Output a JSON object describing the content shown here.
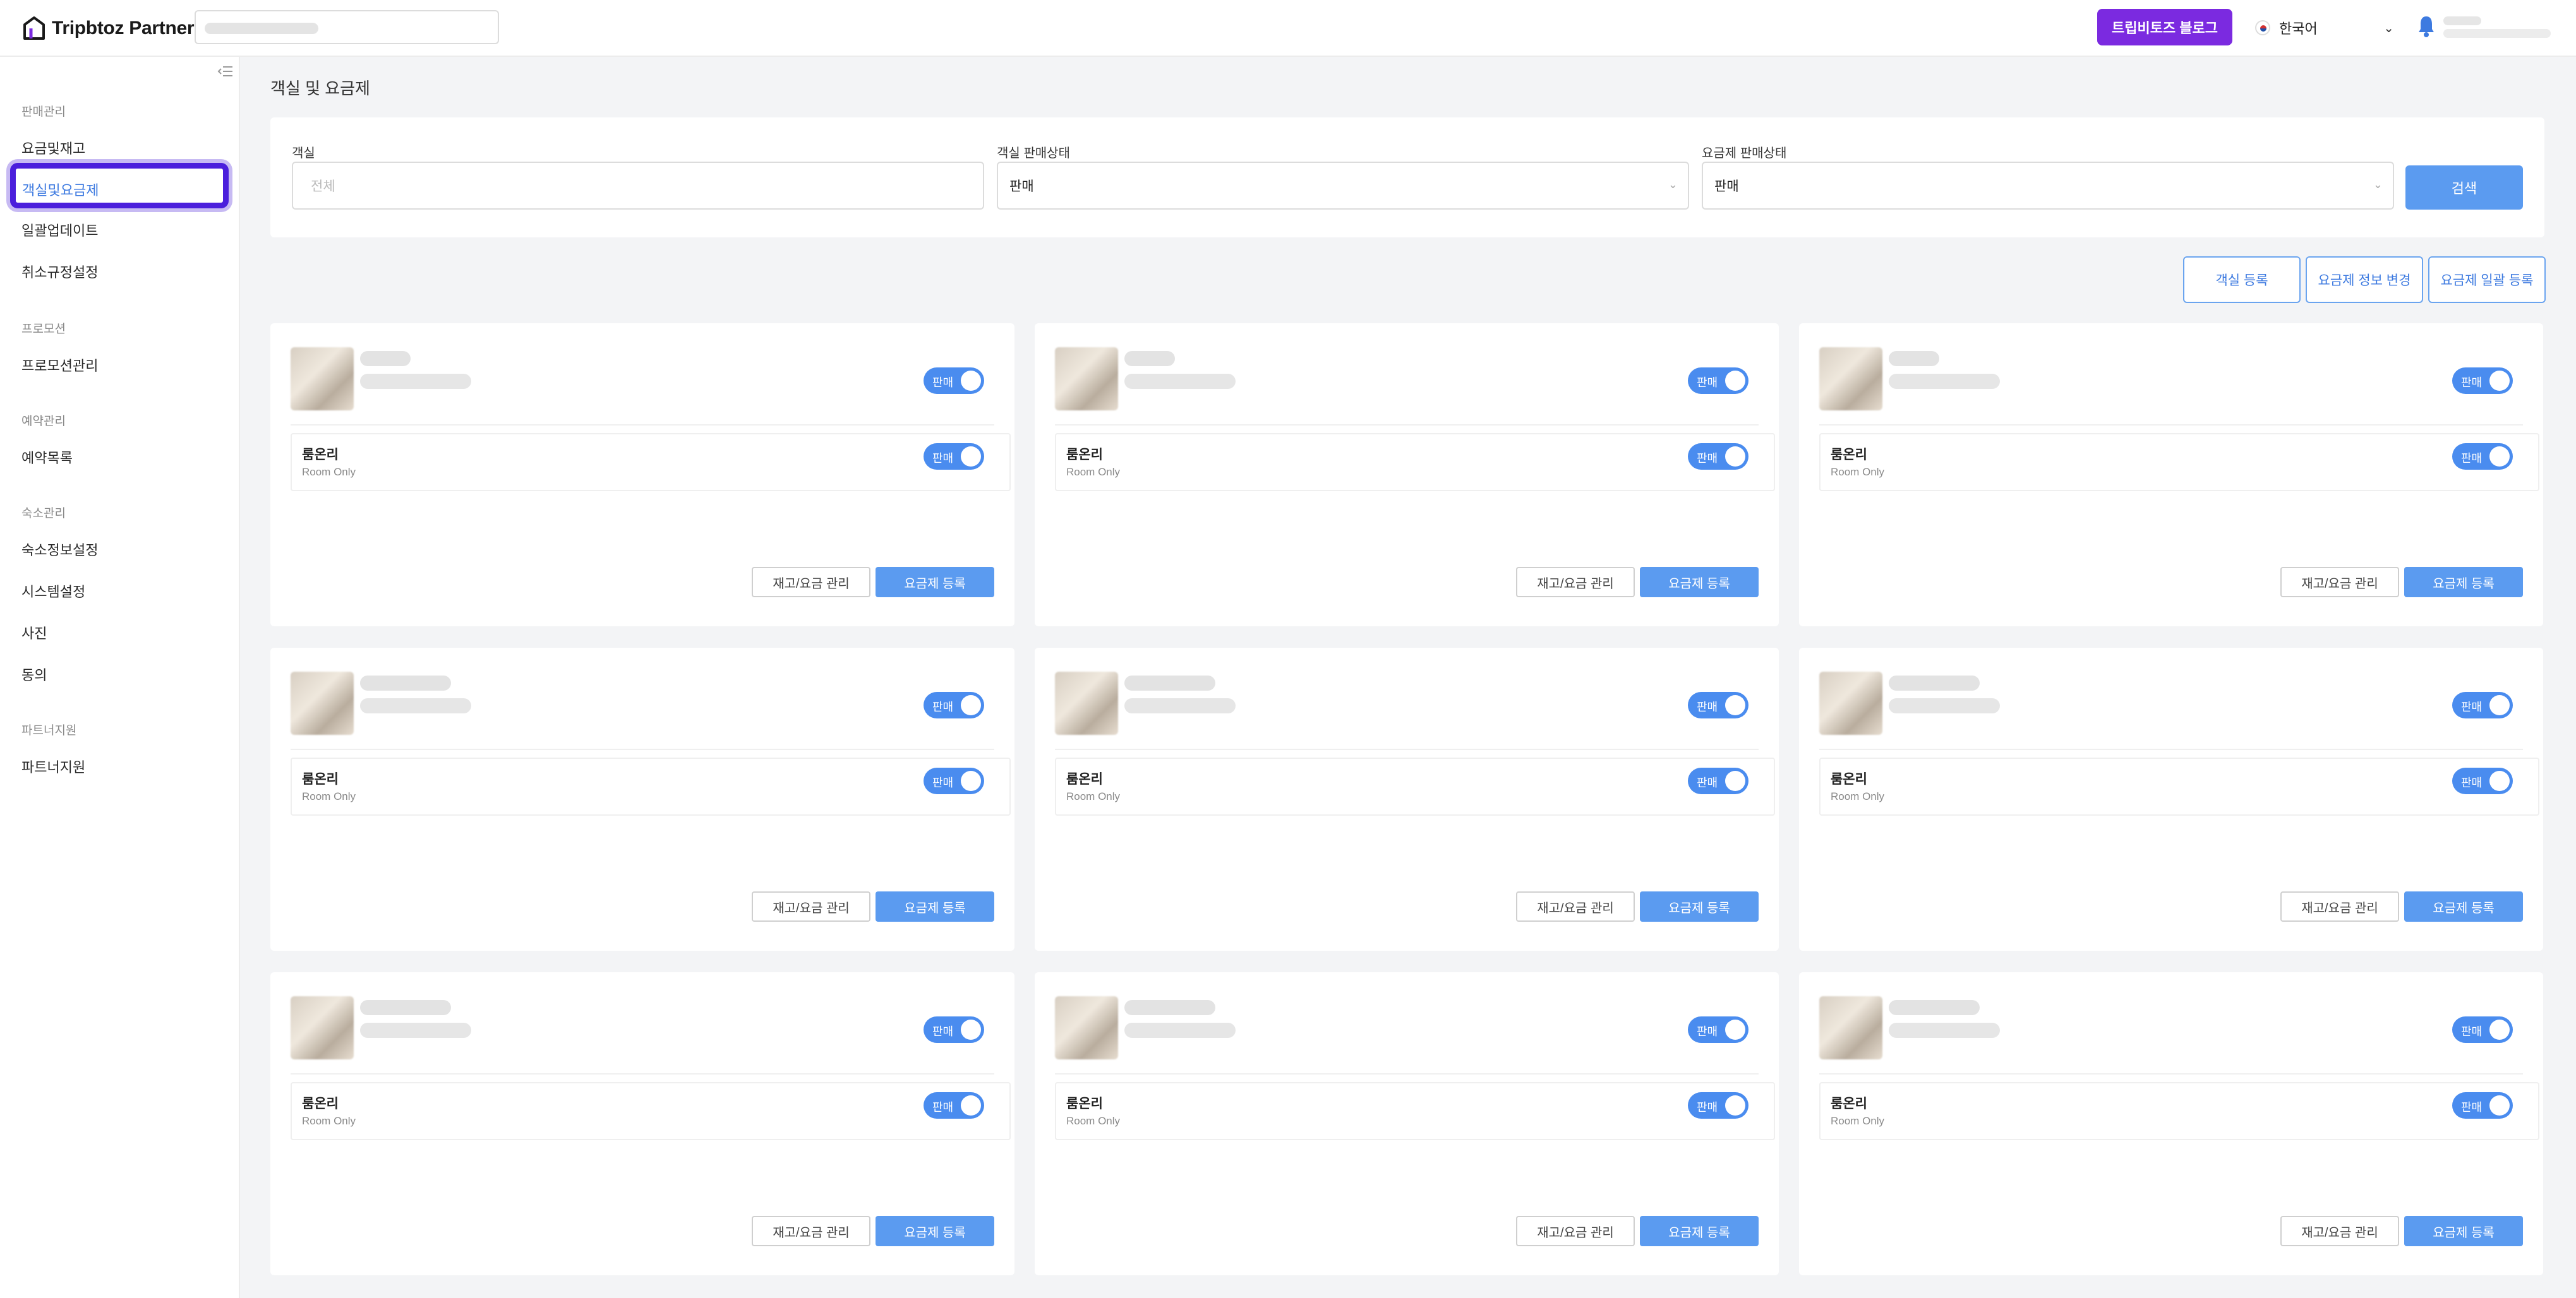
{
  "header": {
    "brand": "Tripbtoz Partner",
    "blog_button": "트립비토즈 블로그",
    "language": "한국어"
  },
  "sidebar": {
    "sections": [
      {
        "title": "판매관리",
        "items": [
          "요금및재고",
          "객실및요금제",
          "일괄업데이트",
          "취소규정설정"
        ]
      },
      {
        "title": "프로모션",
        "items": [
          "프로모션관리"
        ]
      },
      {
        "title": "예약관리",
        "items": [
          "예약목록"
        ]
      },
      {
        "title": "숙소관리",
        "items": [
          "숙소정보설정",
          "시스템설정",
          "사진",
          "동의"
        ]
      },
      {
        "title": "파트너지원",
        "items": [
          "파트너지원"
        ]
      }
    ],
    "active_item": "객실및요금제"
  },
  "main": {
    "page_title": "객실 및 요금제",
    "filters": {
      "room_label": "객실",
      "room_placeholder": "전체",
      "room_status_label": "객실 판매상태",
      "room_status_value": "판매",
      "rate_status_label": "요금제 판매상태",
      "rate_status_value": "판매",
      "search_button": "검색"
    },
    "actions": {
      "register_room": "객실 등록",
      "change_rate_info": "요금제 정보 변경",
      "bulk_register_rate": "요금제 일괄 등록"
    },
    "card": {
      "sale_toggle": "판매",
      "rate_name": "룸온리",
      "rate_sub": "Room Only",
      "manage_button": "재고/요금 관리",
      "register_rate_button": "요금제 등록"
    }
  }
}
